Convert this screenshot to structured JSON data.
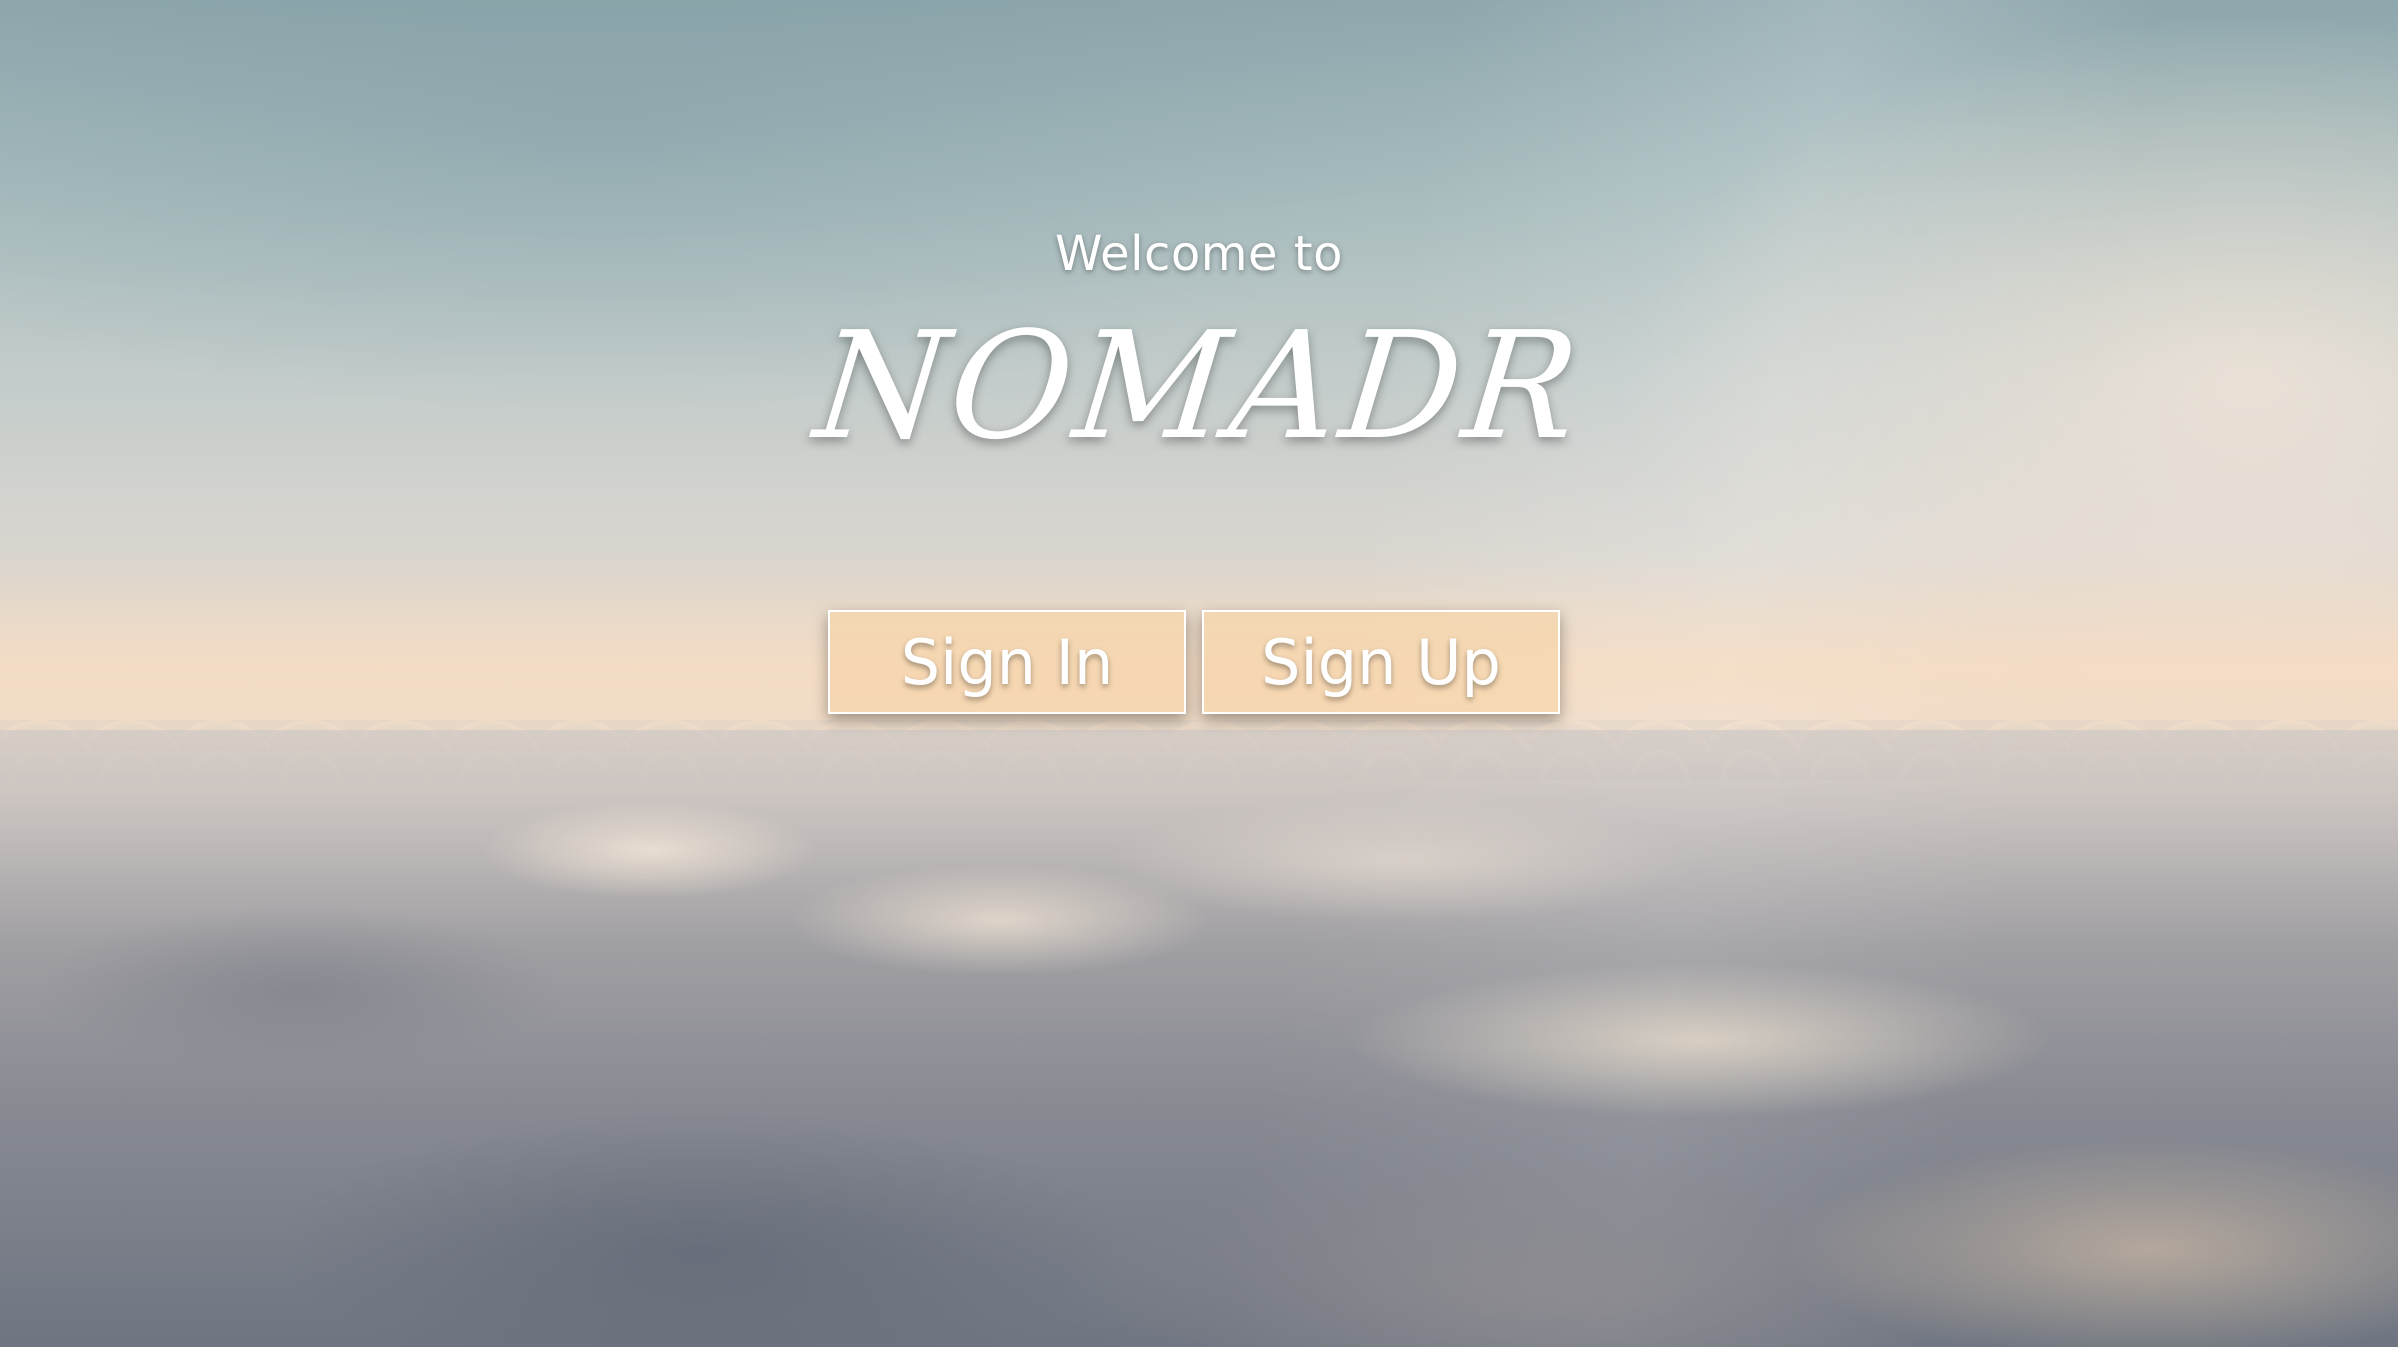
{
  "hero": {
    "welcome_text": "Welcome to",
    "brand_name": "NOMADR"
  },
  "actions": {
    "sign_in_label": "Sign In",
    "sign_up_label": "Sign Up"
  },
  "colors": {
    "button_fill": "#f6d6aa",
    "button_border": "#ffffff",
    "text": "#ffffff"
  }
}
